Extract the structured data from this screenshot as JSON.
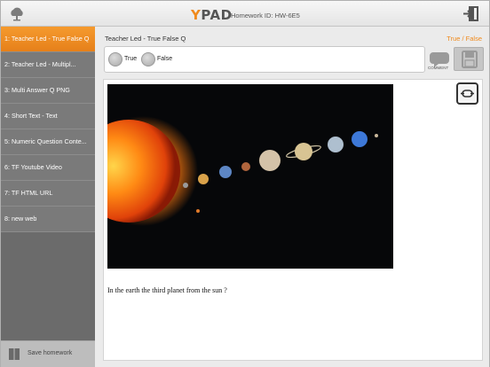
{
  "header": {
    "logo_text": "PAD",
    "logo_prefix": "Y",
    "homework_id": "Homework ID: HW-6E5"
  },
  "sidebar": {
    "items": [
      {
        "label": "1: Teacher Led - True False Q",
        "active": true
      },
      {
        "label": "2: Teacher Led -  Multipl...",
        "active": false
      },
      {
        "label": "3: Multi Answer Q PNG",
        "active": false
      },
      {
        "label": "4: Short Text - Text",
        "active": false
      },
      {
        "label": "5: Numeric Question Conte...",
        "active": false
      },
      {
        "label": "6: TF Youtube Video",
        "active": false
      },
      {
        "label": "7: TF HTML URL",
        "active": false
      },
      {
        "label": "8: new web",
        "active": false
      }
    ],
    "save_label": "Save homework"
  },
  "question": {
    "title": "Teacher Led - True False Q",
    "type": "True / False",
    "options": [
      "True",
      "False"
    ],
    "comment_label": "COMMENT",
    "text": "In the earth the third planet from the sun ?"
  },
  "colors": {
    "accent": "#f08a1c",
    "sidebar_bg": "#7a7a7a"
  }
}
